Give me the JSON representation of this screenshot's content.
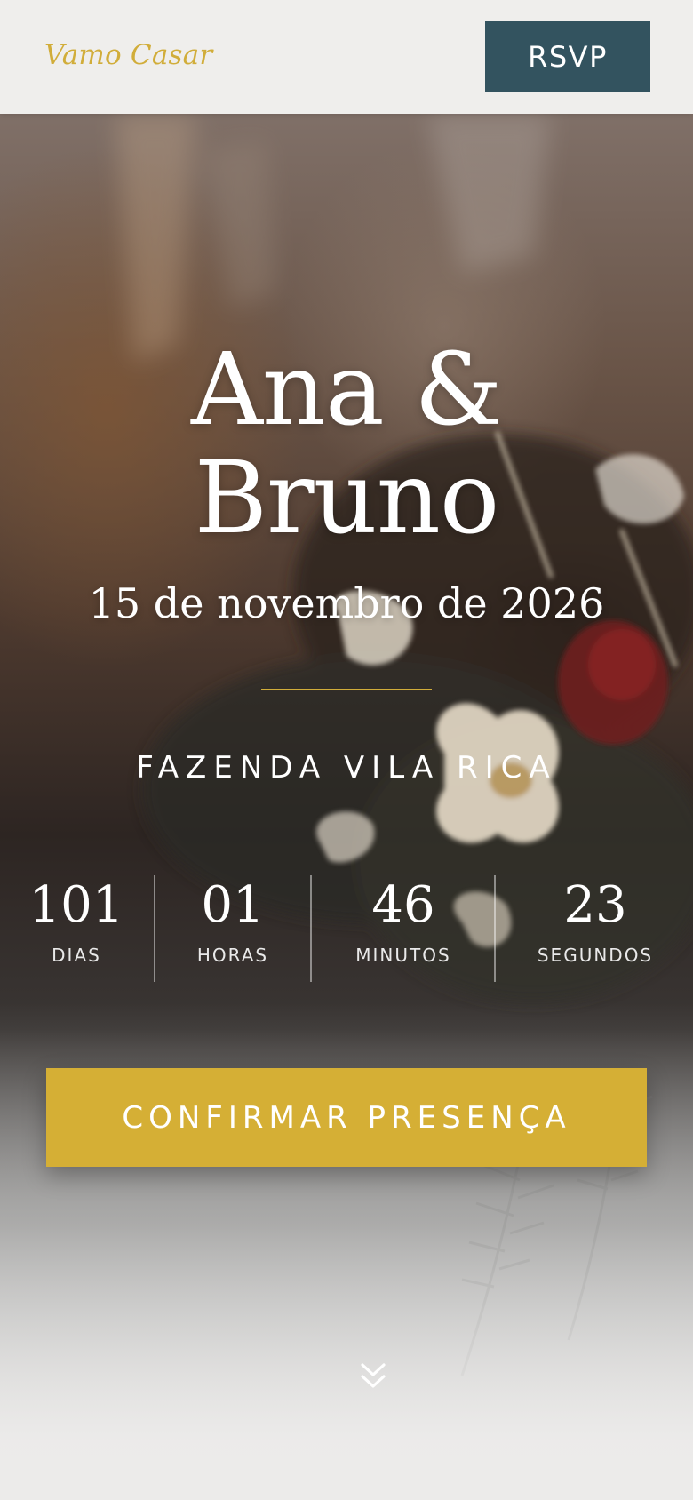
{
  "header": {
    "logo_text": "Vamo Casar",
    "rsvp_label": "RSVP"
  },
  "hero": {
    "name_line_1": "Ana &",
    "name_line_2": "Bruno",
    "date": "15 de novembro de 2026",
    "venue": "FAZENDA VILA RICA",
    "cta_label": "CONFIRMAR PRESENÇA",
    "scroll_icon": "double-chevron-down-icon"
  },
  "countdown": {
    "days": {
      "value": "101",
      "label": "DIAS"
    },
    "hours": {
      "value": "01",
      "label": "HORAS"
    },
    "minutes": {
      "value": "46",
      "label": "MINUTOS"
    },
    "seconds": {
      "value": "23",
      "label": "SEGUNDOS"
    }
  },
  "colors": {
    "accent_gold": "#d5af35",
    "logo_gold": "#d1ad3a",
    "rsvp_button": "#33535f",
    "header_bg": "#efeeec"
  }
}
